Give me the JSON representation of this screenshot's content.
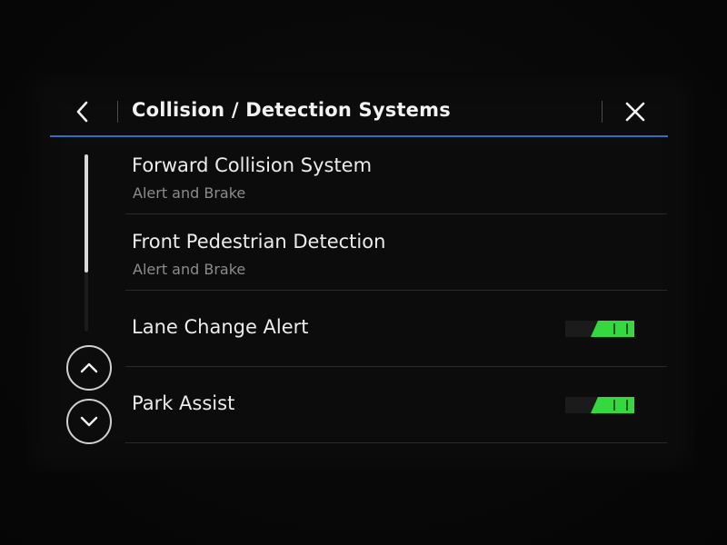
{
  "header": {
    "title": "Collision / Detection Systems",
    "back_icon": "chevron-left-icon",
    "close_icon": "close-icon"
  },
  "scroll": {
    "up_icon": "chevron-up-icon",
    "down_icon": "chevron-down-icon"
  },
  "items": [
    {
      "label": "Forward Collision System",
      "sublabel": "Alert and Brake"
    },
    {
      "label": "Front Pedestrian Detection",
      "sublabel": "Alert and Brake"
    },
    {
      "label": "Lane Change Alert",
      "toggle_on": true
    },
    {
      "label": "Park Assist",
      "toggle_on": true
    }
  ],
  "colors": {
    "accent_line": "#2f6fc4",
    "toggle_on": "#35d83e"
  }
}
